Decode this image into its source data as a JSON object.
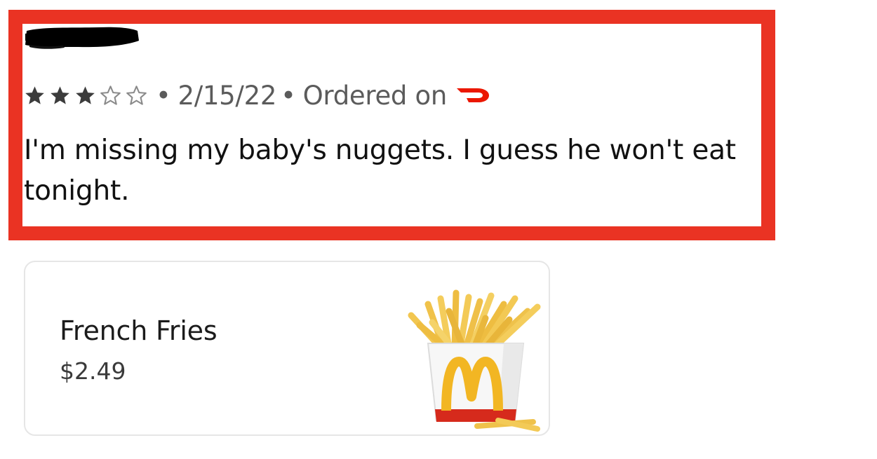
{
  "review": {
    "rating": 3,
    "rating_max": 5,
    "date": "2/15/22",
    "separator": "•",
    "ordered_on_label": "Ordered on",
    "platform_icon": "doordash-logo-icon",
    "text": "I'm missing my baby's nuggets. I guess he won't eat tonight.",
    "reviewer_name_redacted": true
  },
  "item": {
    "name": "French Fries",
    "price": "$2.49",
    "image_icon": "french-fries-image"
  },
  "colors": {
    "highlight_border": "#ea3323",
    "doordash_red": "#eb1700",
    "star": "#3c3c3c",
    "card_border": "#e6e6e6"
  }
}
